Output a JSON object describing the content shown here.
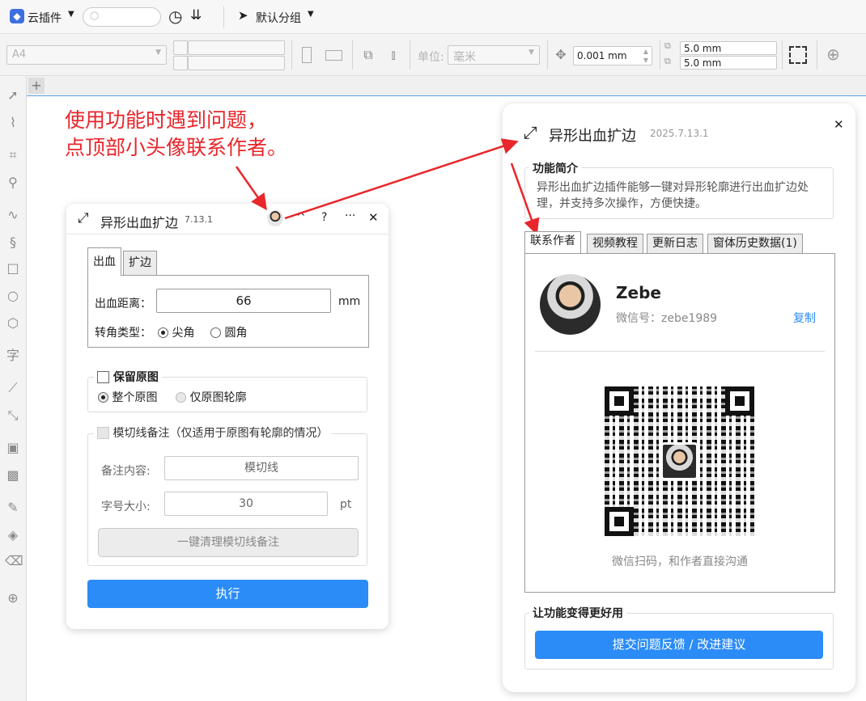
{
  "topbar": {
    "plugin_label": "云插件",
    "group_label": "默认分组"
  },
  "toolbar": {
    "page_size": "A4",
    "unit_label": "单位:",
    "unit_value": "毫米",
    "nudge_value": "0.001 mm",
    "dup_x": "5.0 mm",
    "dup_y": "5.0 mm"
  },
  "annotation": {
    "line1": "使用功能时遇到问题，",
    "line2": "点顶部小头像联系作者。",
    "color": "#e8262b"
  },
  "left_panel": {
    "title": "异形出血扩边",
    "version": "7.13.1",
    "tabs": [
      "出血",
      "扩边"
    ],
    "bleed_label": "出血距离：",
    "bleed_value": "66",
    "bleed_unit": "mm",
    "corner_label": "转角类型：",
    "corner_options": [
      "尖角",
      "圆角"
    ],
    "keep_label": "保留原图",
    "keep_options": [
      "整个原图",
      "仅原图轮廓"
    ],
    "note_label": "模切线备注（仅适用于原图有轮廓的情况）",
    "content_label": "备注内容:",
    "content_value": "模切线",
    "font_label": "字号大小:",
    "font_value": "30",
    "font_unit": "pt",
    "clear_button": "一键清理模切线备注",
    "run_button": "执行"
  },
  "right_panel": {
    "title": "异形出血扩边",
    "version": "2025.7.13.1",
    "intro_title": "功能简介",
    "intro_text": "异形出血扩边插件能够一键对异形轮廓进行出血扩边处理，并支持多次操作，方便快捷。",
    "tabs": [
      "联系作者",
      "视频教程",
      "更新日志",
      "窗体历史数据(1)"
    ],
    "author_name": "Zebe",
    "wechat_label": "微信号：zebe1989",
    "copy_link": "复制",
    "qr_caption": "微信扫码，和作者直接沟通",
    "improve_title": "让功能变得更好用",
    "feedback_button": "提交问题反馈 / 改进建议"
  },
  "colors": {
    "accent": "#2b8cf7",
    "arrow": "#e8262b"
  }
}
